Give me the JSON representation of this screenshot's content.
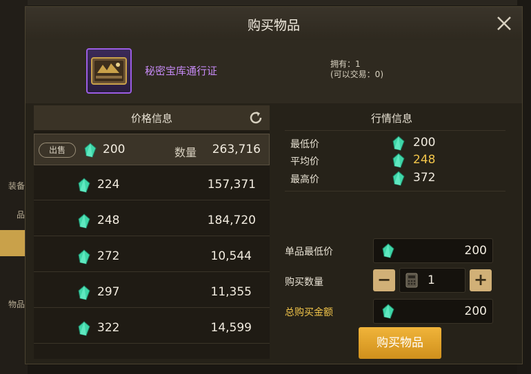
{
  "modal": {
    "title": "购买物品",
    "item_name": "秘密宝库通行证",
    "owned_text": "拥有：1",
    "tradeable_text": "(可以交易：0)"
  },
  "price_panel": {
    "title": "价格信息",
    "sell_tag": "出售",
    "qty_label": "数量",
    "rows": [
      {
        "price": "200",
        "qty": "263,716"
      },
      {
        "price": "224",
        "qty": "157,371"
      },
      {
        "price": "248",
        "qty": "184,720"
      },
      {
        "price": "272",
        "qty": "10,544"
      },
      {
        "price": "297",
        "qty": "11,355"
      },
      {
        "price": "322",
        "qty": "14,599"
      }
    ]
  },
  "market": {
    "title": "行情信息",
    "min_label": "最低价",
    "min_value": "200",
    "avg_label": "平均价",
    "avg_value": "248",
    "max_label": "最高价",
    "max_value": "372"
  },
  "purchase": {
    "unit_min_label": "单品最低价",
    "unit_min_value": "200",
    "quantity_label": "购买数量",
    "quantity_value": "1",
    "total_label": "总购买金额",
    "total_value": "200",
    "buy_button": "购买物品"
  },
  "background_tabs": [
    "装备",
    "品",
    "物品"
  ],
  "colors": {
    "gem": "#3fd6a8",
    "accent_gold": "#f2c54a",
    "buy_button": "#e6a42a",
    "item_rarity": "#9b5de5"
  }
}
